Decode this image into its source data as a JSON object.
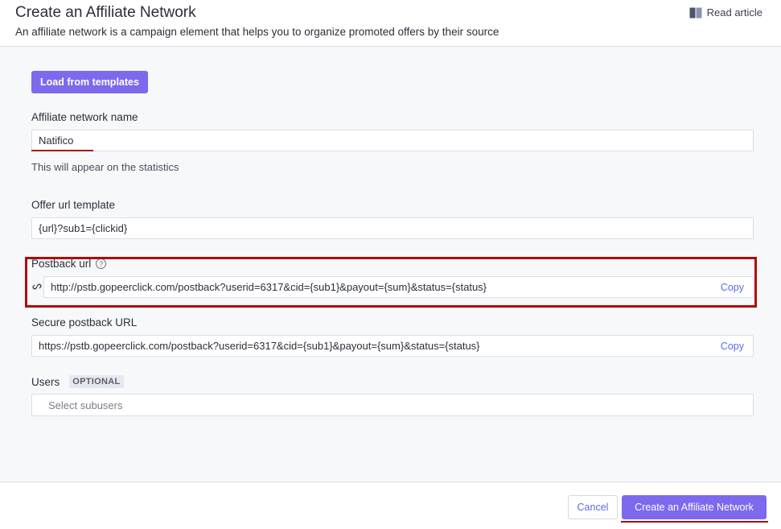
{
  "header": {
    "title": "Create an Affiliate Network",
    "subtitle": "An affiliate network is a campaign element that helps you to organize promoted offers by their source",
    "read_article": "Read article"
  },
  "form": {
    "load_templates": "Load from templates",
    "name_label": "Affiliate network name",
    "name_value": "Natifico",
    "name_hint": "This will appear on the statistics",
    "offer_label": "Offer url template",
    "offer_value": "{url}?sub1={clickid}",
    "postback_label": "Postback url",
    "postback_help": "?",
    "postback_value": "http://pstb.gopeerclick.com/postback?userid=6317&cid={sub1}&payout={sum}&status={status}",
    "postback_copy": "Copy",
    "secure_label": "Secure postback URL",
    "secure_value": "https://pstb.gopeerclick.com/postback?userid=6317&cid={sub1}&payout={sum}&status={status}",
    "secure_copy": "Copy",
    "users_label": "Users",
    "users_optional": "OPTIONAL",
    "users_placeholder": "Select subusers"
  },
  "footer": {
    "cancel": "Cancel",
    "create": "Create an Affiliate Network"
  },
  "colors": {
    "accent": "#7b69ee",
    "link": "#5a6ce8",
    "annotation_red": "#b00a0a"
  }
}
